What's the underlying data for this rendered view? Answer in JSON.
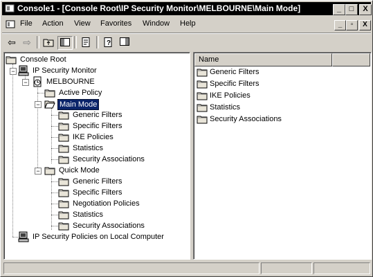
{
  "window": {
    "title": "Console1 - [Console Root\\IP Security Monitor\\MELBOURNE\\Main Mode]",
    "minimize": "_",
    "maximize": "□",
    "close": "X"
  },
  "menubar": {
    "items": [
      "File",
      "Action",
      "View",
      "Favorites",
      "Window",
      "Help"
    ],
    "mdi_minimize": "_",
    "mdi_restore": "▫",
    "mdi_close": "X"
  },
  "toolbar": {
    "back": "⇦",
    "forward": "⇨"
  },
  "tree": {
    "root": "Console Root",
    "monitor": "IP Security Monitor",
    "server": "MELBOURNE",
    "active_policy": "Active Policy",
    "main_mode": "Main Mode",
    "main_children": [
      "Generic Filters",
      "Specific Filters",
      "IKE Policies",
      "Statistics",
      "Security Associations"
    ],
    "quick_mode": "Quick Mode",
    "quick_children": [
      "Generic Filters",
      "Specific Filters",
      "Negotiation Policies",
      "Statistics",
      "Security Associations"
    ],
    "local_policies": "IP Security Policies on Local Computer"
  },
  "list": {
    "column_name": "Name",
    "items": [
      "Generic Filters",
      "Specific Filters",
      "IKE Policies",
      "Statistics",
      "Security Associations"
    ]
  },
  "colors": {
    "selection": "#0a246a",
    "title_bar": "#000000",
    "face": "#d4d0c8"
  }
}
